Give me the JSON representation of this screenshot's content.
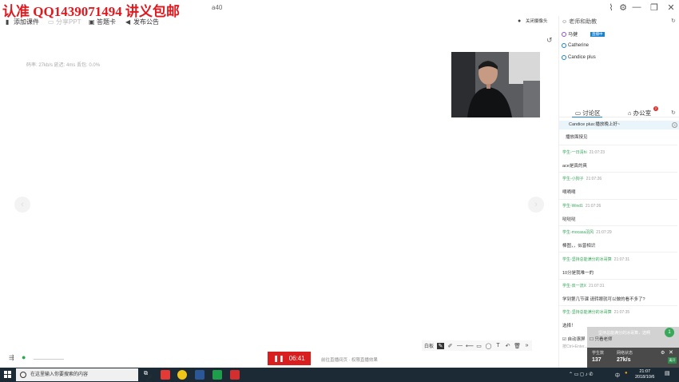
{
  "watermark": {
    "text": "认准 QQ1439071494 讲义包邮",
    "small": "a40"
  },
  "toolbar": {
    "add_course": "添加课件",
    "share_ppt": "分享PPT",
    "answer_card": "答题卡",
    "announce": "发布公告",
    "camera_off": "关闭摄像头"
  },
  "stage": {
    "stats": "码率: 27kb/s   延迟: 4ms   丢包: 0.0%"
  },
  "controls": {
    "timer": "06:41",
    "hint": "前往直播间页 · 权限直播效果"
  },
  "draw_tools": [
    "白板",
    "✎",
    "✐",
    "—",
    "⟵",
    "▭",
    "◯",
    "T",
    "↶",
    "🗑",
    "»"
  ],
  "panel": {
    "title": "老师和助教",
    "members": [
      {
        "name": "马健",
        "badge": "直播中"
      },
      {
        "name": "Catherine",
        "badge": ""
      },
      {
        "name": "Candice plus",
        "badge": ""
      }
    ],
    "tabs": {
      "discussion": "讨论区",
      "office": "办公室",
      "office_count": "2"
    },
    "pinned": "Candice plus:播放晚上好~",
    "first_line": "播放面授见",
    "messages": [
      {
        "user": "学生-一日清hi",
        "time": "21:07:23",
        "text": "ace是真的爽"
      },
      {
        "user": "学生-小狗子",
        "time": "21:07:26",
        "text": "嘀嘀嘀"
      },
      {
        "user": "学生-Wind1",
        "time": "21:07:26",
        "text": "哒哒哒"
      },
      {
        "user": "学生-mocasa羽风",
        "time": "21:07:29",
        "text": "棒图，，似曾相识"
      },
      {
        "user": "学生-坚持总能满分的冰哥算",
        "time": "21:07:31",
        "text": "10分是我唯一的"
      },
      {
        "user": "学生-双一流X",
        "time": "21:07:31",
        "text": "学到第几节课 请转眼就可以做的看不多了?"
      },
      {
        "user": "学生-坚持总能满分的冰哥算",
        "time": "21:07:35",
        "text": "选择！"
      }
    ],
    "popup_text": "坚持总能满分的冰哥算，选啊",
    "auto_scroll": "自动滚屏",
    "only_teacher": "只看老师",
    "input_placeholder": "按Ctrl+Enter..."
  },
  "netbox": {
    "students_label": "学生数",
    "students": "137",
    "upload_label": "网络状态",
    "upload": "27k/s",
    "button": "离开"
  },
  "taskbar": {
    "search_placeholder": "在这里输入你要搜索的内容",
    "time": "21:07",
    "date": "2018/10/6",
    "tray_lang": "中"
  }
}
